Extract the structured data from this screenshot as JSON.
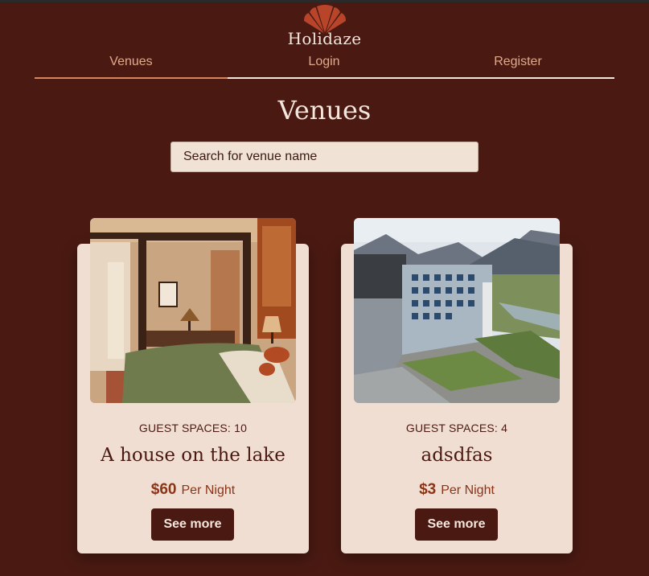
{
  "brand": {
    "name": "Holidaze"
  },
  "nav": {
    "items": [
      "Venues",
      "Login",
      "Register"
    ],
    "active": "Venues"
  },
  "page": {
    "title": "Venues"
  },
  "search": {
    "placeholder": "Search for venue name"
  },
  "venues": [
    {
      "guests": "GUEST SPACES: 10",
      "name": "A house on the lake",
      "price": "$60",
      "per": "Per Night",
      "button": "See more",
      "image": "hotel-bedroom-photo"
    },
    {
      "guests": "GUEST SPACES: 4",
      "name": "adsdfas",
      "price": "$3",
      "per": "Per Night",
      "button": "See more",
      "image": "hotel-building-aerial-photo"
    }
  ],
  "colors": {
    "background": "#4a1a12",
    "card": "#f1ded2",
    "accent": "#d6865c",
    "price": "#8a3418"
  },
  "icons": {
    "logo": "seashell-logo-icon"
  }
}
